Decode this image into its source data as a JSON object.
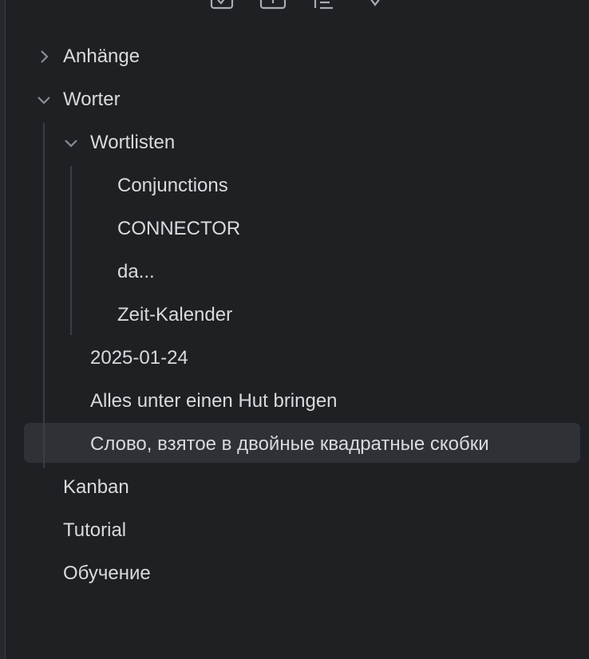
{
  "toolbar": {
    "buttons": [
      {
        "icon": "new-note-icon"
      },
      {
        "icon": "new-folder-icon"
      },
      {
        "icon": "sort-icon"
      },
      {
        "icon": "collapse-all-icon"
      }
    ]
  },
  "tree": {
    "items": [
      {
        "label": "Anhänge",
        "level": 0,
        "expanded": false,
        "folder": true
      },
      {
        "label": "Worter",
        "level": 0,
        "expanded": true,
        "folder": true
      },
      {
        "label": "Wortlisten",
        "level": 1,
        "expanded": true,
        "folder": true
      },
      {
        "label": "Conjunctions",
        "level": 2,
        "folder": false
      },
      {
        "label": "CONNECTOR",
        "level": 2,
        "folder": false
      },
      {
        "label": "da...",
        "level": 2,
        "folder": false
      },
      {
        "label": "Zeit-Kalender",
        "level": 2,
        "folder": false
      },
      {
        "label": "2025-01-24",
        "level": 1,
        "folder": false
      },
      {
        "label": "Alles unter einen Hut bringen",
        "level": 1,
        "folder": false
      },
      {
        "label": "Слово, взятое в двойные квадратные скобки",
        "level": 1,
        "folder": false,
        "selected": true
      },
      {
        "label": "Kanban",
        "level": 0,
        "folder": false
      },
      {
        "label": "Tutorial",
        "level": 0,
        "folder": false
      },
      {
        "label": "Обучение",
        "level": 0,
        "folder": false
      }
    ]
  },
  "colors": {
    "background": "#1e2024",
    "text": "#d8dadd",
    "chevron": "#8a8d93",
    "selected": "#2e3136",
    "guide": "#3a3d43"
  }
}
